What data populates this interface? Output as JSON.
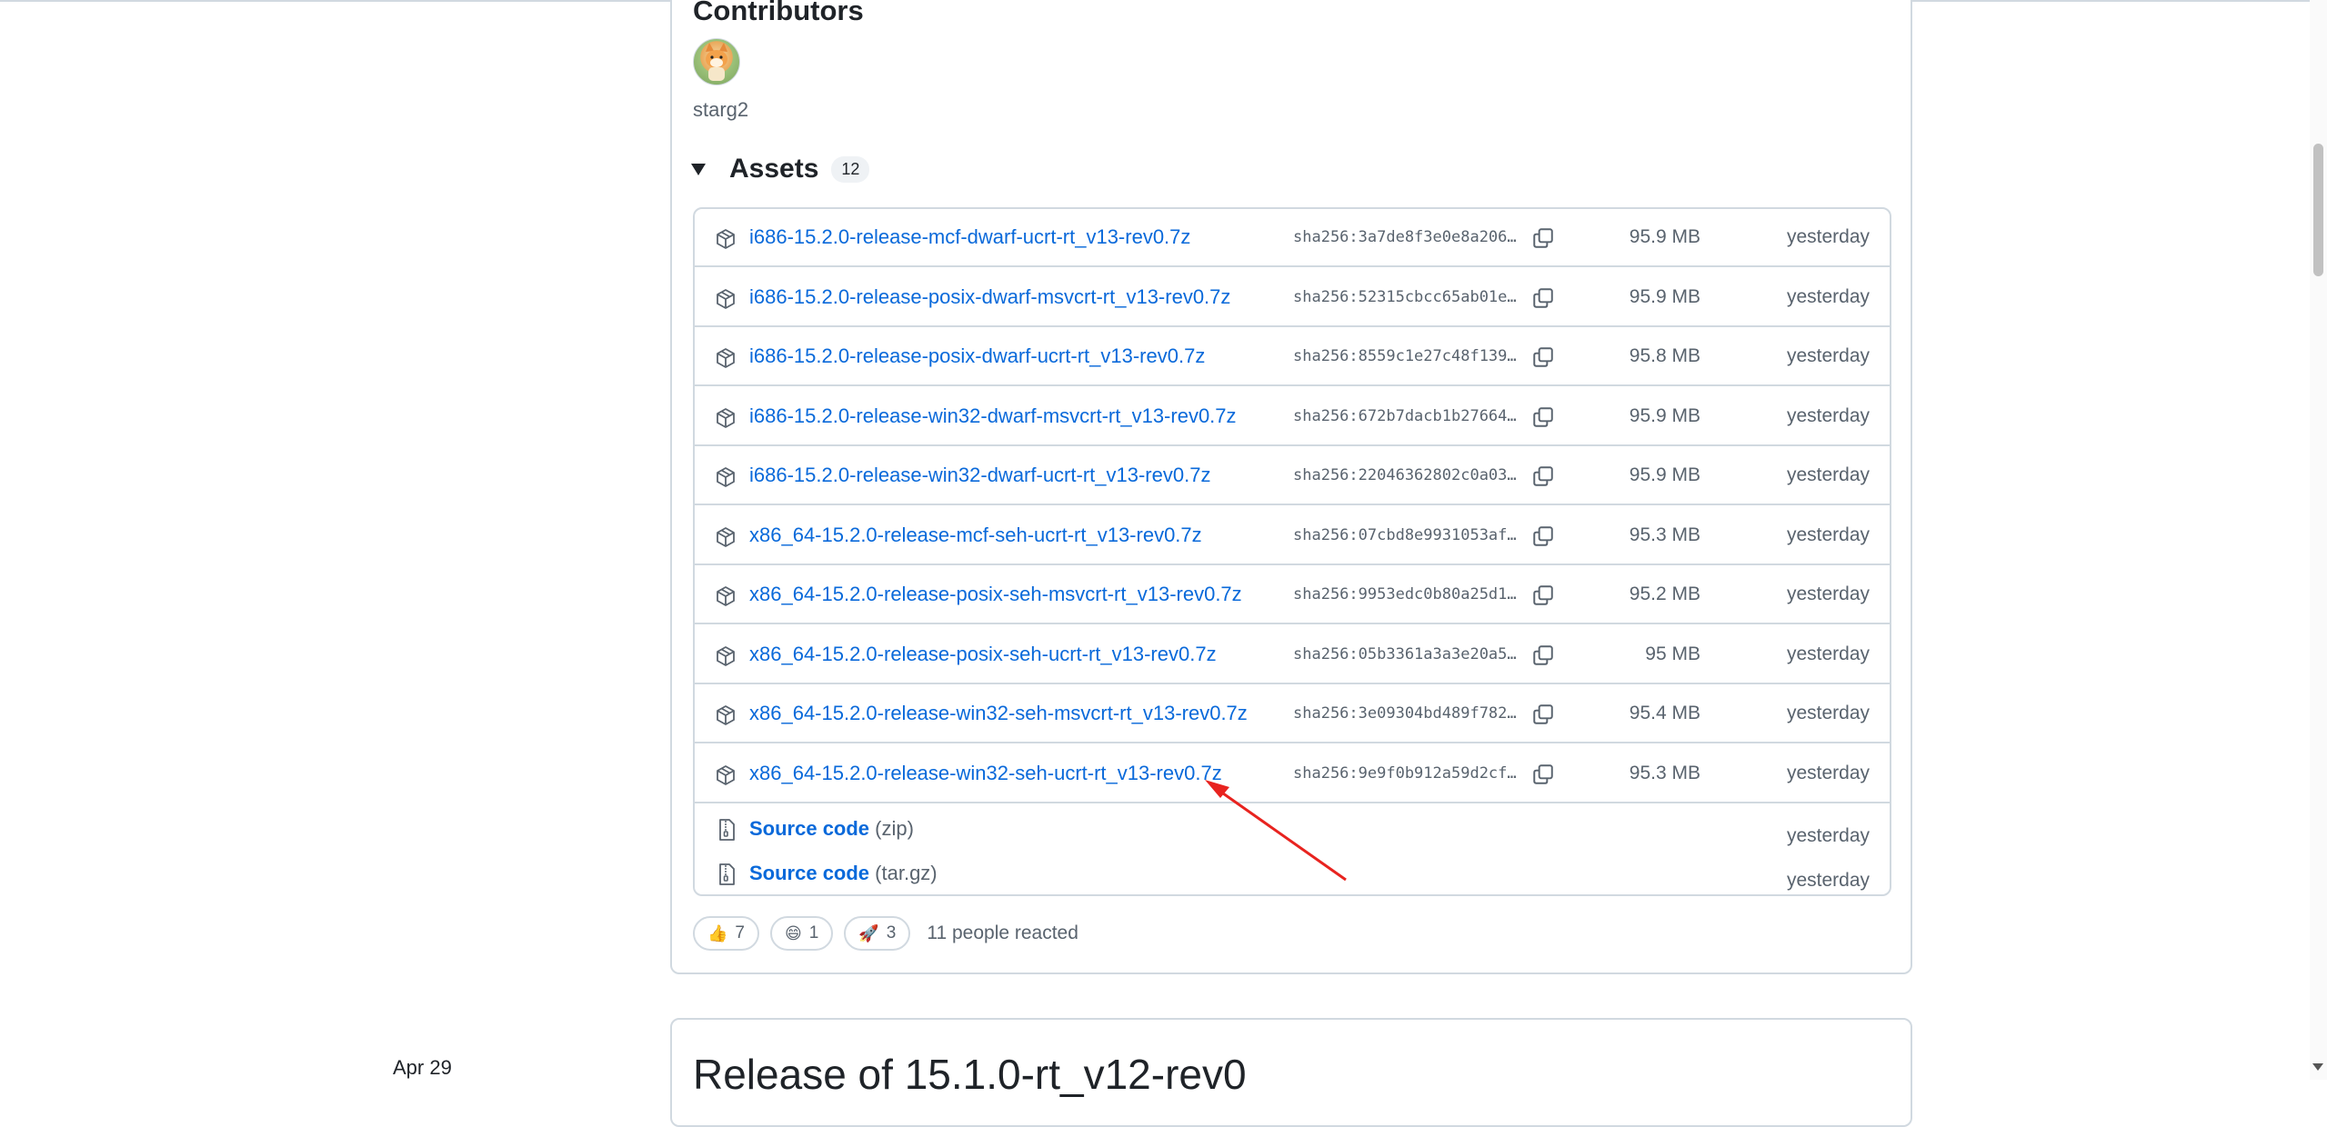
{
  "release": {
    "contributors_title": "Contributors",
    "contributor": {
      "name": "starg2",
      "avatar_icon": "fox-avatar-icon"
    },
    "assets_title": "Assets",
    "assets_count": "12",
    "assets": [
      {
        "name": "i686-15.2.0-release-mcf-dwarf-ucrt-rt_v13-rev0.7z",
        "sha": "sha256:3a7de8f3e0e8a206b…",
        "size": "95.9 MB",
        "date": "yesterday"
      },
      {
        "name": "i686-15.2.0-release-posix-dwarf-msvcrt-rt_v13-rev0.7z",
        "sha": "sha256:52315cbcc65ab01eb…",
        "size": "95.9 MB",
        "date": "yesterday"
      },
      {
        "name": "i686-15.2.0-release-posix-dwarf-ucrt-rt_v13-rev0.7z",
        "sha": "sha256:8559c1e27c48f1394…",
        "size": "95.8 MB",
        "date": "yesterday"
      },
      {
        "name": "i686-15.2.0-release-win32-dwarf-msvcrt-rt_v13-rev0.7z",
        "sha": "sha256:672b7dacb1b276640…",
        "size": "95.9 MB",
        "date": "yesterday"
      },
      {
        "name": "i686-15.2.0-release-win32-dwarf-ucrt-rt_v13-rev0.7z",
        "sha": "sha256:22046362802c0a03a…",
        "size": "95.9 MB",
        "date": "yesterday"
      },
      {
        "name": "x86_64-15.2.0-release-mcf-seh-ucrt-rt_v13-rev0.7z",
        "sha": "sha256:07cbd8e9931053afc…",
        "size": "95.3 MB",
        "date": "yesterday"
      },
      {
        "name": "x86_64-15.2.0-release-posix-seh-msvcrt-rt_v13-rev0.7z",
        "sha": "sha256:9953edc0b80a25d1c…",
        "size": "95.2 MB",
        "date": "yesterday"
      },
      {
        "name": "x86_64-15.2.0-release-posix-seh-ucrt-rt_v13-rev0.7z",
        "sha": "sha256:05b3361a3a3e20a57…",
        "size": "95 MB",
        "date": "yesterday"
      },
      {
        "name": "x86_64-15.2.0-release-win32-seh-msvcrt-rt_v13-rev0.7z",
        "sha": "sha256:3e09304bd489f7822…",
        "size": "95.4 MB",
        "date": "yesterday"
      },
      {
        "name": "x86_64-15.2.0-release-win32-seh-ucrt-rt_v13-rev0.7z",
        "sha": "sha256:9e9f0b912a59d2cfb…",
        "size": "95.3 MB",
        "date": "yesterday"
      }
    ],
    "source_code": [
      {
        "label": "Source code",
        "ext": "(zip)",
        "date": "yesterday"
      },
      {
        "label": "Source code",
        "ext": "(tar.gz)",
        "date": "yesterday"
      }
    ],
    "reactions": [
      {
        "emoji": "👍",
        "icon": "thumbs-up-icon",
        "count": "7"
      },
      {
        "emoji": "😄",
        "icon": "laugh-icon",
        "count": "1"
      },
      {
        "emoji": "🚀",
        "icon": "rocket-icon",
        "count": "3"
      }
    ],
    "reactions_summary": "11 people reacted"
  },
  "next_release": {
    "date": "Apr 29",
    "title": "Release of 15.1.0-rt_v12-rev0"
  },
  "colors": {
    "link": "#0969da",
    "muted": "#59636e",
    "border": "#d1d9e0",
    "annotation_arrow": "#e8231f"
  }
}
